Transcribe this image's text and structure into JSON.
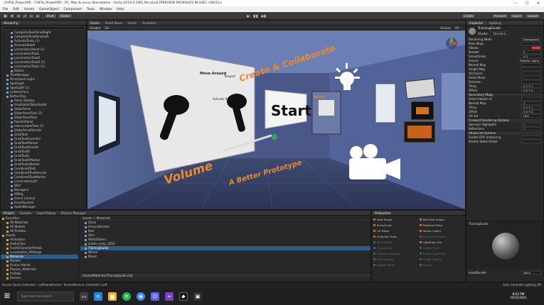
{
  "window": {
    "title": "CHFSI_ProjectXR - CHFSI_ProjectXR - PC, Mac & Linux Standalone - Unity 2019.4.18f1 Personal [PREVIEW PACKAGES IN USE] <DX11>"
  },
  "menu": [
    "File",
    "Edit",
    "Assets",
    "GameObject",
    "Component",
    "Tools",
    "Window",
    "Help"
  ],
  "toolbar": {
    "tools": [
      "✋",
      "✥",
      "⟲",
      "⤢",
      "▭",
      "⊕"
    ],
    "pivot": "Pivot",
    "global": "Global",
    "play": "▶",
    "pause": "❚❚",
    "step": "▶❚",
    "account": "Account",
    "layers": "Layers",
    "layout": "Layout",
    "collab": "Collab"
  },
  "hierarchy": {
    "tab": "Hierarchy",
    "items": [
      "CompleteTaskPanelRight",
      "CompleteTaskPanelLeft",
      "ActivateTaskL (1)",
      "ActivateTaskR",
      "LocomotionHand (1)",
      "LocomotionTaskL",
      "LocomotionTaskR",
      "LocomotionTaskR (1)",
      "LocomotionTaskL (1)",
      "Button",
      "TaskManager",
      "Directional Light",
      "SpotLight",
      "SpotLight (1)",
      "ListInterface",
      "ButtonTray",
      "Panel_Display",
      "GrabbableTableOutlet",
      "SliderPanel",
      "SliderPanelTask (1)",
      "SliderPanelTask",
      "ResultsPanel",
      "InteractableTask (1)",
      "SliderPanelResults",
      "GrabTask",
      "GrabTaskInverted",
      "GrabTaskMarker",
      "GrabTaskResults",
      "GrabTaskR",
      "GrabTaskL",
      "GrabTaskRMarker",
      "GrabTaskLMarker",
      "CombinedTask",
      "CombinedTaskResults",
      "CombinedTaskMarker",
      "LocomotionLeft",
      "Wall",
      "Managers",
      "XRRig",
      "Game Control",
      "EventSystem",
      "AudioManager",
      "RaycastLocator"
    ]
  },
  "scene": {
    "tabs": [
      "Scene",
      "Asset Store",
      "Game",
      "Animator"
    ],
    "toolbar": [
      "Shaded",
      "2D",
      "Gizmos",
      "All"
    ],
    "signs": {
      "left_panel_title": "Move Around",
      "activate": "Activate It",
      "grab": "Grab It",
      "teleport": "Teleport",
      "start": "Start",
      "volume": "Volume",
      "ribbon1": "Create & Collaborate",
      "ribbon2": "A Better Prototype",
      "vertical": "Record"
    }
  },
  "inspector": {
    "tabs": [
      "Inspector",
      "Lighting"
    ],
    "material": "TrainingGuide",
    "shader_label": "Shader",
    "shader": "Standard",
    "props": [
      {
        "k": "Rendering Mode",
        "v": "Transparent"
      },
      {
        "k": "Main Maps",
        "v": ""
      },
      {
        "k": "Albedo",
        "v": ""
      },
      {
        "k": "Metallic",
        "v": "0"
      },
      {
        "k": "Smoothness",
        "v": "0.5"
      },
      {
        "k": "Source",
        "v": "Metallic Alpha"
      },
      {
        "k": "Normal Map",
        "v": ""
      },
      {
        "k": "Height Map",
        "v": ""
      },
      {
        "k": "Occlusion",
        "v": ""
      },
      {
        "k": "Detail Mask",
        "v": ""
      },
      {
        "k": "Emission",
        "v": ""
      },
      {
        "k": "Tiling",
        "v": "X 1  Y 1"
      },
      {
        "k": "Offset",
        "v": "X 0  Y 0"
      }
    ],
    "secondary": "Secondary Maps",
    "props2": [
      {
        "k": "Detail Albedo x2",
        "v": ""
      },
      {
        "k": "Normal Map",
        "v": "1"
      },
      {
        "k": "Tiling",
        "v": "X 1  Y 1"
      },
      {
        "k": "Offset",
        "v": "X 0  Y 0"
      },
      {
        "k": "UV Set",
        "v": "UV0"
      }
    ],
    "forward": "Forward Rendering Options",
    "props3": [
      {
        "k": "Specular Highlights",
        "v": "✓"
      },
      {
        "k": "Reflections",
        "v": "✓"
      }
    ],
    "advanced": "Advanced Options",
    "props4": [
      {
        "k": "Enable GPU Instancing",
        "v": ""
      },
      {
        "k": "Double Sided Global",
        "v": ""
      }
    ],
    "preview_label": "TrainingGuide",
    "bundle": "AssetBundle",
    "bundle_v": "None",
    "autogen": "Auto Generate Lighting Off"
  },
  "project": {
    "tabs": [
      "Project",
      "Console",
      "Input Debug",
      "Physics Manager"
    ],
    "tree": [
      "Favorites",
      "All Materials",
      "All Models",
      "All Prefabs",
      "Assets",
      "Animation",
      "AudioClips",
      "FixedCharacterPrefab",
      "Locomotion_VRStage",
      "Materials",
      "Models",
      "Oculus Hands",
      "Physics_Materials",
      "Prefabs",
      "Scenes"
    ],
    "selected_tree": "Materials",
    "crumb": "Assets > Materials",
    "files": [
      "Glass",
      "GroundShader",
      "Red",
      "Skin",
      "WallsSliders",
      "ladder_emp_1050",
      "TrainingGuide",
      "Wheel",
      "Wood"
    ],
    "selected_file": "TrainingGuide",
    "path": "Assets/Materials/TrainingGuide.mat"
  },
  "production": {
    "tab": "Production",
    "items": [
      {
        "label": "New Shape",
        "on": true
      },
      {
        "label": "New Poly Shape",
        "on": true
      },
      {
        "label": "Smoothing",
        "on": true
      },
      {
        "label": "Material Editor",
        "on": true
      },
      {
        "label": "UV Editor",
        "on": true
      },
      {
        "label": "Vertex Colors",
        "on": true
      },
      {
        "label": "Selection Tools",
        "on": true
      },
      {
        "label": "Subdivide Object",
        "on": false
      },
      {
        "label": "Pivot Editor",
        "on": false
      },
      {
        "label": "Lightmap UVs",
        "on": true
      },
      {
        "label": "Triangulate",
        "on": false
      },
      {
        "label": "Center Pivot",
        "on": false
      },
      {
        "label": "Conform Normals",
        "on": false
      },
      {
        "label": "Freeze Transform",
        "on": false
      },
      {
        "label": "Flip Normals",
        "on": false
      },
      {
        "label": "Merge Objects",
        "on": false
      },
      {
        "label": "Detach Faces",
        "on": false
      },
      {
        "label": "Export",
        "on": false
      }
    ]
  },
  "status": {
    "left": "Oculus Touch Controller - LeftHandAnchor: TrackedDevice::Controller: Left",
    "right": "Auto Generate Lighting Off"
  },
  "taskbar": {
    "search": "Type here to search",
    "time": "8:02 PM",
    "date": "10/22/2021"
  }
}
